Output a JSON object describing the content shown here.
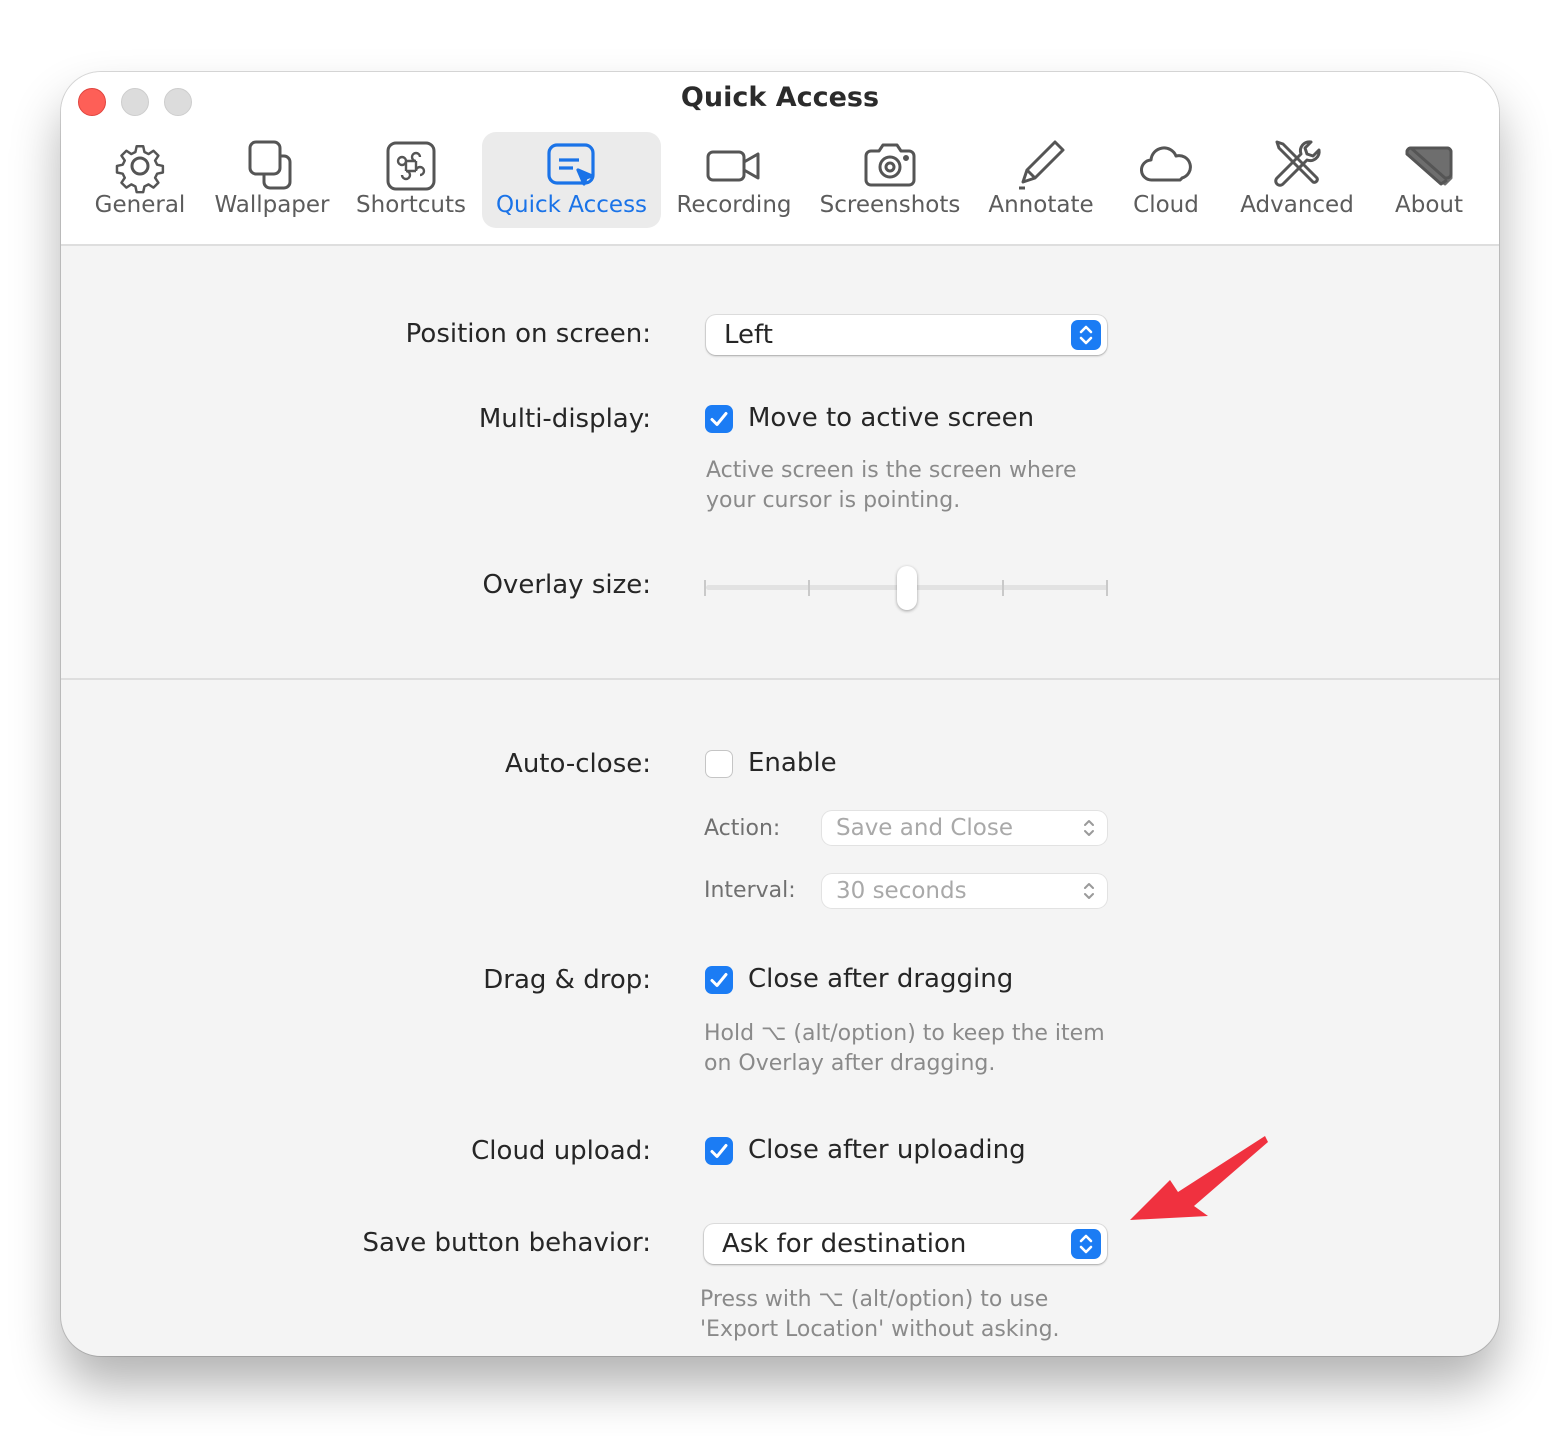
{
  "window": {
    "title": "Quick Access"
  },
  "toolbar": {
    "tabs": [
      {
        "label": "General",
        "icon": "gear-icon"
      },
      {
        "label": "Wallpaper",
        "icon": "wallpaper-icon"
      },
      {
        "label": "Shortcuts",
        "icon": "command-key-icon"
      },
      {
        "label": "Quick Access",
        "icon": "quick-access-icon",
        "active": true
      },
      {
        "label": "Recording",
        "icon": "video-camera-icon"
      },
      {
        "label": "Screenshots",
        "icon": "camera-icon"
      },
      {
        "label": "Annotate",
        "icon": "pencil-icon"
      },
      {
        "label": "Cloud",
        "icon": "cloud-icon"
      },
      {
        "label": "Advanced",
        "icon": "tools-icon"
      },
      {
        "label": "About",
        "icon": "about-icon"
      }
    ]
  },
  "settings": {
    "position": {
      "label": "Position on screen:",
      "value": "Left"
    },
    "multi_display": {
      "label": "Multi-display:",
      "checkbox_label": "Move to active screen",
      "checked": true,
      "help_line1": "Active screen is the screen where",
      "help_line2": "your cursor is pointing."
    },
    "overlay_size": {
      "label": "Overlay size:",
      "value_fraction": 0.5,
      "ticks": 5
    },
    "auto_close": {
      "label": "Auto-close:",
      "checkbox_label": "Enable",
      "checked": false,
      "action_label": "Action:",
      "action_value": "Save and Close",
      "interval_label": "Interval:",
      "interval_value": "30 seconds"
    },
    "drag_drop": {
      "label": "Drag & drop:",
      "checkbox_label": "Close after dragging",
      "checked": true,
      "help_line1": "Hold ⌥ (alt/option) to keep the item",
      "help_line2": "on Overlay after dragging."
    },
    "cloud_upload": {
      "label": "Cloud upload:",
      "checkbox_label": "Close after uploading",
      "checked": true
    },
    "save_button": {
      "label": "Save button behavior:",
      "value": "Ask for destination",
      "help_line1": "Press with ⌥ (alt/option) to use",
      "help_line2": "'Export Location' without asking."
    }
  },
  "colors": {
    "accent": "#1b7cf4",
    "annotation_arrow": "#f0313f"
  }
}
